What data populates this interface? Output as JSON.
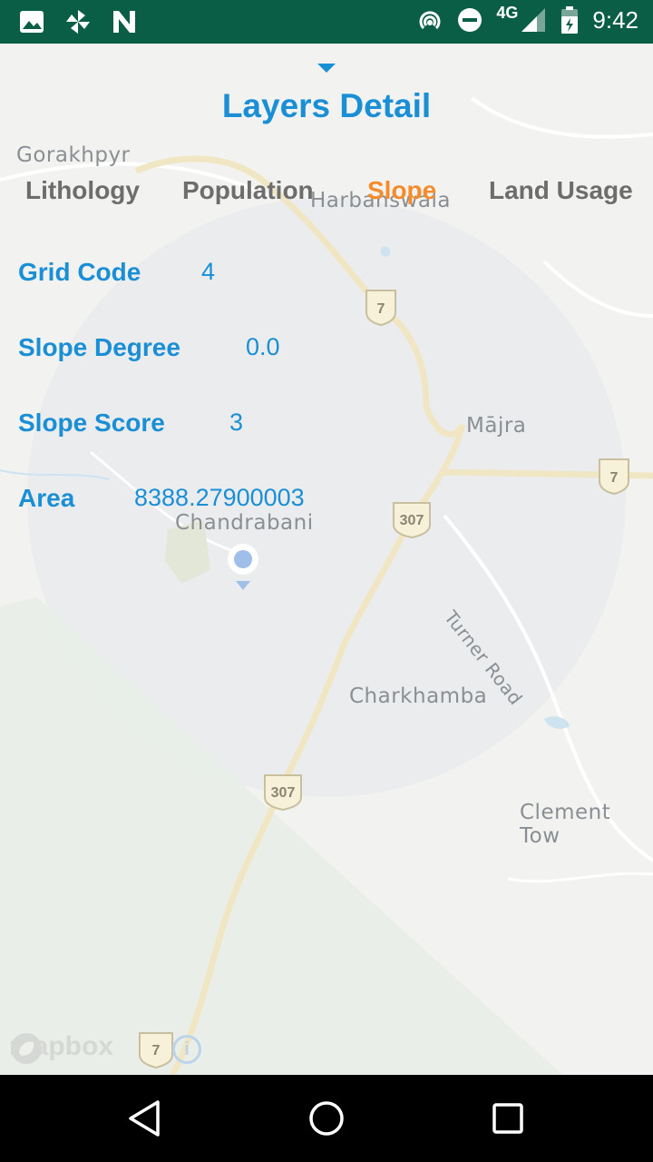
{
  "status_bar": {
    "network": "4G",
    "time": "9:42",
    "icons": [
      "image-icon",
      "pinwheel-icon",
      "n-logo-icon",
      "hotspot-icon",
      "do-not-disturb-icon",
      "signal-icon",
      "battery-icon"
    ]
  },
  "panel": {
    "title": "Layers Detail",
    "tabs": [
      {
        "label": "Lithology",
        "active": false
      },
      {
        "label": "Population",
        "active": false
      },
      {
        "label": "Slope",
        "active": true
      },
      {
        "label": "Land Usage",
        "active": false
      }
    ],
    "fields": [
      {
        "label": "Grid Code",
        "value": "4"
      },
      {
        "label": "Slope Degree",
        "value": "0.0"
      },
      {
        "label": "Slope Score",
        "value": "3"
      },
      {
        "label": "Area",
        "value": "8388.27900003"
      }
    ],
    "colors": {
      "accent": "#1a8fd6",
      "active_tab": "#f58b2a",
      "inactive_tab": "#6d6d6d"
    }
  },
  "map": {
    "places": [
      "Gorakhpyr",
      "Harbanswala",
      "Mājra",
      "Chandrabani",
      "Turner Road",
      "Charkhamba",
      "Clement Tow"
    ],
    "road_shields": [
      "7",
      "7",
      "307",
      "307",
      "7"
    ],
    "attribution": "mapbox",
    "info": "i"
  }
}
